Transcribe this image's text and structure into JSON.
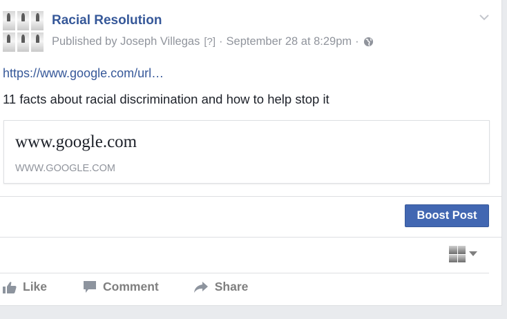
{
  "post": {
    "page_name": "Racial Resolution",
    "meta": {
      "published_by": "Published by Joseph Villegas",
      "help_marker": "[?]",
      "separator": "·",
      "timestamp": "September 28 at 8:29pm",
      "privacy_icon": "globe-icon"
    },
    "link_text": "https://www.google.com/url…",
    "message": "11 facts about racial discrimination and how to help stop it",
    "preview": {
      "title": "www.google.com",
      "domain": "WWW.GOOGLE.COM"
    },
    "options_icon": "chevron-down-icon"
  },
  "boost": {
    "label": "Boost Post",
    "color": "#4267b2"
  },
  "actions": {
    "like": {
      "label": "Like",
      "icon": "thumbs-up-icon"
    },
    "comment": {
      "label": "Comment",
      "icon": "comment-icon"
    },
    "share": {
      "label": "Share",
      "icon": "share-arrow-icon"
    }
  },
  "actor_selector": {
    "icon": "caret-down-icon"
  },
  "colors": {
    "link": "#365899",
    "meta": "#90949c",
    "text": "#1d2129",
    "action_text": "#7f7f7f",
    "background": "#e9ebee"
  }
}
